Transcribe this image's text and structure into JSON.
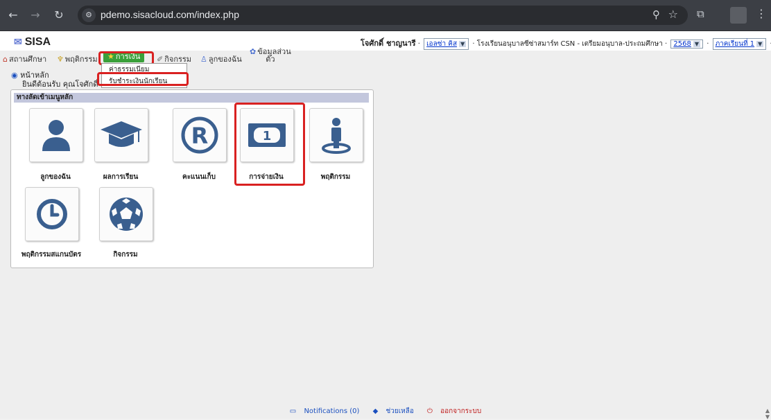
{
  "browser": {
    "url": "pdemo.sisacloud.com/index.php"
  },
  "app": {
    "logo": "SISA"
  },
  "header": {
    "user_name": "โจศักดิ์ ชาญนารี",
    "child_select": "เอลซ่า คิส",
    "school": "โรงเรียนอนุบาลซีซ่าสมาร์ท CSN - เตรียมอนุบาล-ประถมศึกษา",
    "year_select": "2568",
    "term_select": "ภาคเรียนที่ 1"
  },
  "menu": {
    "items": [
      {
        "label": "สถานศึกษา",
        "icon": "school-icon"
      },
      {
        "label": "พฤติกรรม",
        "icon": "behavior-icon"
      },
      {
        "label": "การเงิน",
        "icon": "finance-icon"
      },
      {
        "label": "กิจกรรม",
        "icon": "activity-icon"
      },
      {
        "label": "ลูกของฉัน",
        "icon": "child-icon"
      },
      {
        "label": "ข้อมูลส่วน",
        "label2": "ตัว",
        "icon": "profile-icon"
      }
    ],
    "dropdown": [
      "ค่าธรรมเนียม",
      "รับชำระเงินนักเรียน"
    ]
  },
  "breadcrumb": {
    "home": "หน้าหลัก",
    "welcome": "ยินดีต้อนรับ คุณโจศักดิ์"
  },
  "panel": {
    "title": "ทางลัดเข้าเมนูหลัก",
    "tiles": [
      {
        "label": "ลูกของฉัน",
        "icon": "user-icon"
      },
      {
        "label": "ผลการเรียน",
        "icon": "graduation-cap-icon"
      },
      {
        "label": "คะแนนเก็บ",
        "icon": "registered-icon"
      },
      {
        "label": "การจ่ายเงิน",
        "icon": "money-icon"
      },
      {
        "label": "พฤติกรรม",
        "icon": "person-marker-icon"
      },
      {
        "label": "พฤติกรรมสแกนบัตร",
        "icon": "clock-icon"
      },
      {
        "label": "กิจกรรม",
        "icon": "soccer-ball-icon"
      }
    ]
  },
  "footer": {
    "notifications": "Notifications (0)",
    "help": "ช่วยเหลือ",
    "logout": "ออกจากระบบ"
  },
  "colors": {
    "accent_green": "#3aa03a",
    "highlight_red": "#d92121",
    "icon_blue": "#3a5f8f",
    "panel_header": "#c3c7dd"
  }
}
